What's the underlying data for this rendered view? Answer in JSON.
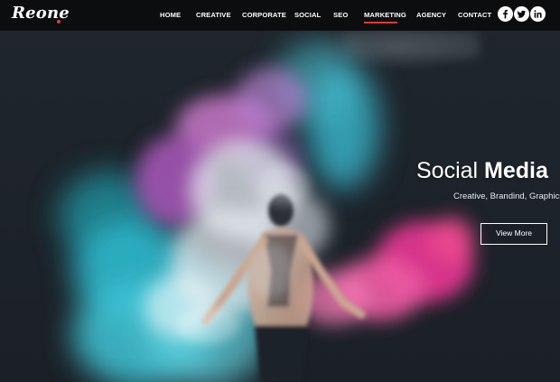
{
  "brand": {
    "logo_text": "Reone",
    "accent_color": "#e8373a"
  },
  "nav": {
    "items": [
      {
        "label": "HOME"
      },
      {
        "label": "CREATIVE"
      },
      {
        "label": "CORPORATE"
      },
      {
        "label": "SOCIAL"
      },
      {
        "label": "SEO"
      },
      {
        "label": "MARKETING",
        "active": true
      },
      {
        "label": "AGENCY"
      },
      {
        "label": "CONTACT"
      }
    ]
  },
  "social": {
    "icons": [
      "facebook-icon",
      "twitter-icon",
      "linkedin-icon"
    ]
  },
  "hero": {
    "title_light": "Social",
    "title_bold": "Media",
    "subtitle": "Creative, Brandind, Graphics",
    "button_label": "View More",
    "image": "person-in-colored-smoke"
  },
  "colors": {
    "header_bg": "#0c0d0f",
    "hero_bg": "#1c2229",
    "smoke_cyan": "#3fc3d6",
    "smoke_magenta": "#d8368f",
    "smoke_purple": "#b06ac4",
    "smoke_white": "#dfe6ec"
  }
}
